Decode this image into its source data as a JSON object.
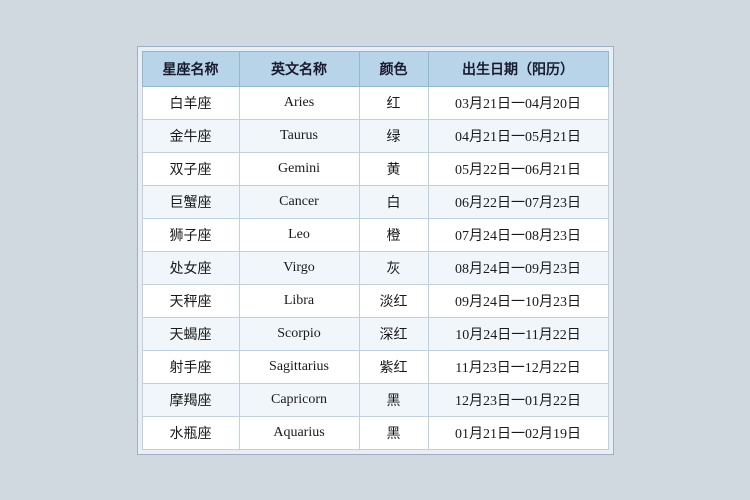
{
  "table": {
    "headers": {
      "chinese_name": "星座名称",
      "english_name": "英文名称",
      "color": "颜色",
      "birth_date": "出生日期（阳历）"
    },
    "rows": [
      {
        "chinese": "白羊座",
        "english": "Aries",
        "color": "红",
        "date": "03月21日一04月20日"
      },
      {
        "chinese": "金牛座",
        "english": "Taurus",
        "color": "绿",
        "date": "04月21日一05月21日"
      },
      {
        "chinese": "双子座",
        "english": "Gemini",
        "color": "黄",
        "date": "05月22日一06月21日"
      },
      {
        "chinese": "巨蟹座",
        "english": "Cancer",
        "color": "白",
        "date": "06月22日一07月23日"
      },
      {
        "chinese": "狮子座",
        "english": "Leo",
        "color": "橙",
        "date": "07月24日一08月23日"
      },
      {
        "chinese": "处女座",
        "english": "Virgo",
        "color": "灰",
        "date": "08月24日一09月23日"
      },
      {
        "chinese": "天秤座",
        "english": "Libra",
        "color": "淡红",
        "date": "09月24日一10月23日"
      },
      {
        "chinese": "天蝎座",
        "english": "Scorpio",
        "color": "深红",
        "date": "10月24日一11月22日"
      },
      {
        "chinese": "射手座",
        "english": "Sagittarius",
        "color": "紫红",
        "date": "11月23日一12月22日"
      },
      {
        "chinese": "摩羯座",
        "english": "Capricorn",
        "color": "黑",
        "date": "12月23日一01月22日"
      },
      {
        "chinese": "水瓶座",
        "english": "Aquarius",
        "color": "黑",
        "date": "01月21日一02月19日"
      }
    ]
  }
}
